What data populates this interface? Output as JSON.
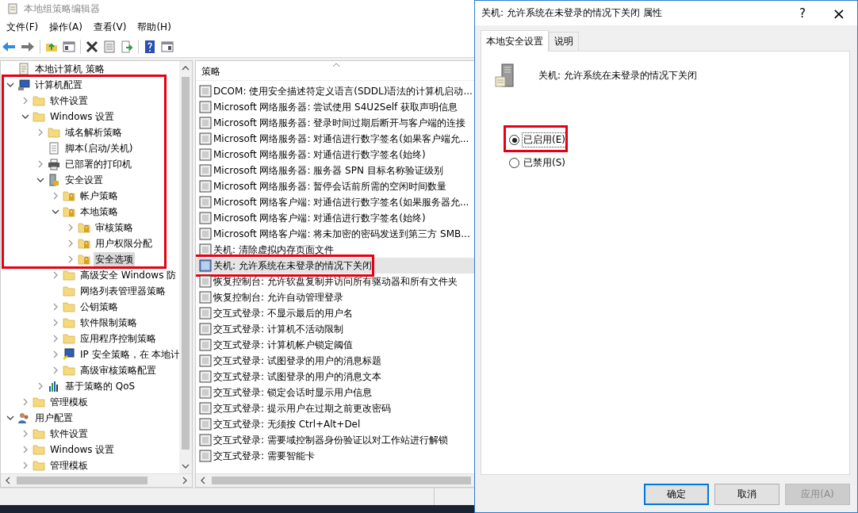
{
  "window": {
    "title": "本地组策略编辑器"
  },
  "menu": [
    "文件(F)",
    "操作(A)",
    "查看(V)",
    "帮助(H)"
  ],
  "tree": {
    "highlighted": true,
    "items": [
      {
        "label": "本地计算机 策略",
        "kind": "document",
        "selected": false
      },
      {
        "label": "计算机配置",
        "kind": "computer",
        "expanded": true,
        "selected": false,
        "children": [
          {
            "label": "软件设置",
            "kind": "folder",
            "expanded": false,
            "selected": false
          },
          {
            "label": "Windows 设置",
            "kind": "folder",
            "expanded": true,
            "selected": false,
            "children": [
              {
                "label": "域名解析策略",
                "kind": "folder",
                "expanded": false,
                "selected": false
              },
              {
                "label": "脚本(启动/关机)",
                "kind": "script",
                "selected": false
              },
              {
                "label": "已部署的打印机",
                "kind": "printer",
                "expanded": false,
                "selected": false
              },
              {
                "label": "安全设置",
                "kind": "security",
                "expanded": true,
                "selected": false,
                "children": [
                  {
                    "label": "帐户策略",
                    "kind": "lock-folder",
                    "expanded": false,
                    "selected": false
                  },
                  {
                    "label": "本地策略",
                    "kind": "lock-folder",
                    "expanded": true,
                    "selected": false,
                    "children": [
                      {
                        "label": "审核策略",
                        "kind": "lock-folder",
                        "expanded": false,
                        "selected": false
                      },
                      {
                        "label": "用户权限分配",
                        "kind": "lock-folder",
                        "expanded": false,
                        "selected": false
                      },
                      {
                        "label": "安全选项",
                        "kind": "lock-folder",
                        "expanded": false,
                        "selected": true
                      }
                    ]
                  },
                  {
                    "label": "高级安全 Windows 防",
                    "kind": "folder",
                    "expanded": false,
                    "selected": false
                  },
                  {
                    "label": "网络列表管理器策略",
                    "kind": "folder",
                    "selected": false
                  },
                  {
                    "label": "公钥策略",
                    "kind": "folder",
                    "expanded": false,
                    "selected": false
                  },
                  {
                    "label": "软件限制策略",
                    "kind": "folder",
                    "expanded": false,
                    "selected": false
                  },
                  {
                    "label": "应用程序控制策略",
                    "kind": "folder",
                    "expanded": false,
                    "selected": false
                  },
                  {
                    "label": "IP 安全策略，在 本地计",
                    "kind": "network",
                    "expanded": false,
                    "selected": false
                  },
                  {
                    "label": "高级审核策略配置",
                    "kind": "folder",
                    "expanded": false,
                    "selected": false
                  }
                ]
              },
              {
                "label": "基于策略的 QoS",
                "kind": "chart",
                "expanded": false,
                "selected": false
              }
            ]
          },
          {
            "label": "管理模板",
            "kind": "folder",
            "expanded": false,
            "selected": false
          }
        ]
      },
      {
        "label": "用户配置",
        "kind": "user",
        "expanded": true,
        "selected": false,
        "children": [
          {
            "label": "软件设置",
            "kind": "folder",
            "expanded": false,
            "selected": false
          },
          {
            "label": "Windows 设置",
            "kind": "folder",
            "expanded": false,
            "selected": false
          },
          {
            "label": "管理模板",
            "kind": "folder",
            "expanded": false,
            "selected": false
          }
        ]
      }
    ]
  },
  "policies": {
    "column": "策略",
    "rows": [
      {
        "label": "DCOM: 使用安全描述符定义语言(SDDL)语法的计算机启动...",
        "selected": false,
        "highlighted": false
      },
      {
        "label": "Microsoft 网络服务器: 尝试使用 S4U2Self 获取声明信息",
        "selected": false,
        "highlighted": false
      },
      {
        "label": "Microsoft 网络服务器: 登录时间过期后断开与客户端的连接",
        "selected": false,
        "highlighted": false
      },
      {
        "label": "Microsoft 网络服务器: 对通信进行数字签名(如果客户端允...",
        "selected": false,
        "highlighted": false
      },
      {
        "label": "Microsoft 网络服务器: 对通信进行数字签名(始终)",
        "selected": false,
        "highlighted": false
      },
      {
        "label": "Microsoft 网络服务器: 服务器 SPN 目标名称验证级别",
        "selected": false,
        "highlighted": false
      },
      {
        "label": "Microsoft 网络服务器: 暂停会话前所需的空闲时间数量",
        "selected": false,
        "highlighted": false
      },
      {
        "label": "Microsoft 网络客户端: 对通信进行数字签名(如果服务器允...",
        "selected": false,
        "highlighted": false
      },
      {
        "label": "Microsoft 网络客户端: 对通信进行数字签名(始终)",
        "selected": false,
        "highlighted": false
      },
      {
        "label": "Microsoft 网络客户端: 将未加密的密码发送到第三方 SMB...",
        "selected": false,
        "highlighted": false
      },
      {
        "label": "关机: 清除虚拟内存页面文件",
        "selected": false,
        "highlighted": false
      },
      {
        "label": "关机: 允许系统在未登录的情况下关闭",
        "selected": true,
        "highlighted": true
      },
      {
        "label": "恢复控制台: 允许软盘复制并访问所有驱动器和所有文件夹",
        "selected": false,
        "highlighted": false
      },
      {
        "label": "恢复控制台: 允许自动管理登录",
        "selected": false,
        "highlighted": false
      },
      {
        "label": "交互式登录: 不显示最后的用户名",
        "selected": false,
        "highlighted": false
      },
      {
        "label": "交互式登录: 计算机不活动限制",
        "selected": false,
        "highlighted": false
      },
      {
        "label": "交互式登录: 计算机帐户锁定阈值",
        "selected": false,
        "highlighted": false
      },
      {
        "label": "交互式登录: 试图登录的用户的消息标题",
        "selected": false,
        "highlighted": false
      },
      {
        "label": "交互式登录: 试图登录的用户的消息文本",
        "selected": false,
        "highlighted": false
      },
      {
        "label": "交互式登录: 锁定会话时显示用户信息",
        "selected": false,
        "highlighted": false
      },
      {
        "label": "交互式登录: 提示用户在过期之前更改密码",
        "selected": false,
        "highlighted": false
      },
      {
        "label": "交互式登录: 无须按 Ctrl+Alt+Del",
        "selected": false,
        "highlighted": false
      },
      {
        "label": "交互式登录: 需要域控制器身份验证以对工作站进行解锁",
        "selected": false,
        "highlighted": false
      },
      {
        "label": "交互式登录: 需要智能卡",
        "selected": false,
        "highlighted": false
      }
    ]
  },
  "dialog": {
    "title": "关机: 允许系统在未登录的情况下关闭 属性",
    "help": "?",
    "close": "×",
    "tabs": [
      {
        "label": "本地安全设置",
        "selected": true
      },
      {
        "label": "说明",
        "selected": false
      }
    ],
    "policy_name": "关机: 允许系统在未登录的情况下关闭",
    "radios": [
      {
        "label": "已启用(E)",
        "selected": true,
        "highlighted": true
      },
      {
        "label": "已禁用(S)",
        "selected": false,
        "highlighted": false
      }
    ],
    "buttons": [
      {
        "label": "确定",
        "default": true,
        "disabled": false
      },
      {
        "label": "取消",
        "default": false,
        "disabled": false
      },
      {
        "label": "应用(A)",
        "default": false,
        "disabled": true
      }
    ]
  }
}
